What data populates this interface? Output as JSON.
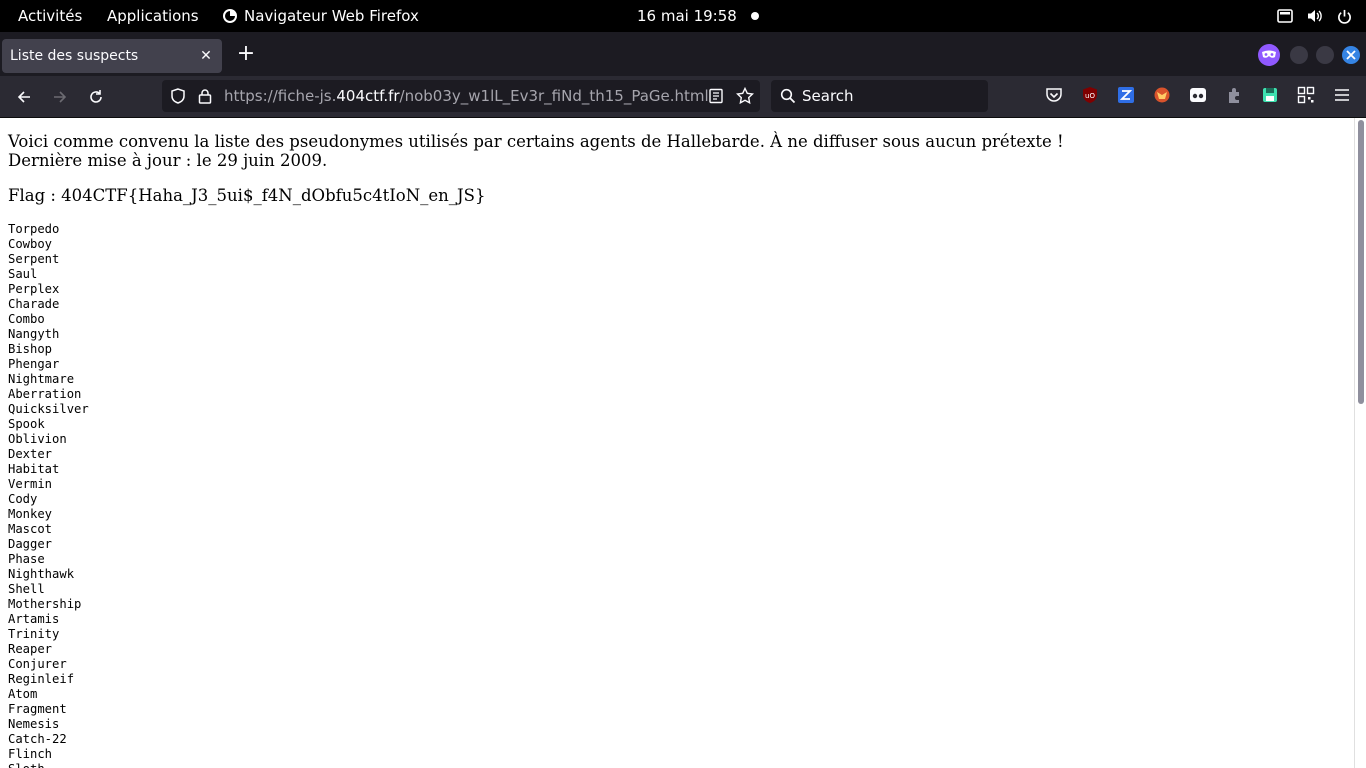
{
  "topbar": {
    "activities": "Activités",
    "applications": "Applications",
    "app_name": "Navigateur Web Firefox",
    "clock": "16 mai  19:58"
  },
  "tabs": [
    {
      "title": "Liste des suspects",
      "active": true
    }
  ],
  "navbar": {
    "url_prefix": "https://fiche-js.",
    "url_host": "404ctf.fr",
    "url_path": "/nob03y_w1lL_Ev3r_fiNd_th15_PaGe.html",
    "search_placeholder": "Search"
  },
  "page": {
    "intro_line1": "Voici comme convenu la liste des pseudonymes utilisés par certains agents de Hallebarde. À ne diffuser sous aucun prétexte !",
    "intro_line2": "Dernière mise à jour : le 29 juin 2009.",
    "flag": "Flag : 404CTF{Haha_J3_5ui$_f4N_dObfu5c4tIoN_en_JS}",
    "names": [
      "Torpedo",
      "Cowboy",
      "Serpent",
      "Saul",
      "Perplex",
      "Charade",
      "Combo",
      "Nangyth",
      "Bishop",
      "Phengar",
      "Nightmare",
      "Aberration",
      "Quicksilver",
      "Spook",
      "Oblivion",
      "Dexter",
      "Habitat",
      "Vermin",
      "Cody",
      "Monkey",
      "Mascot",
      "Dagger",
      "Phase",
      "Nighthawk",
      "Shell",
      "Mothership",
      "Artamis",
      "Trinity",
      "Reaper",
      "Conjurer",
      "Reginleif",
      "Atom",
      "Fragment",
      "Nemesis",
      "Catch-22",
      "Flinch",
      "Sloth"
    ]
  },
  "colors": {
    "topbar_bg": "#000000",
    "tabstrip_bg": "#1c1b22",
    "toolbar_bg": "#2b2a33",
    "private_accent": "#9059ff",
    "close_button": "#3584e4"
  }
}
